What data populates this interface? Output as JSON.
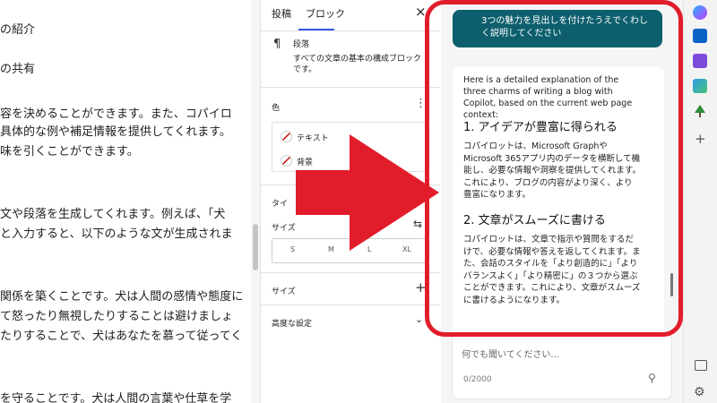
{
  "editor": {
    "lines": [
      "の紹介",
      "の共有",
      "容を決めることができます。また、コパイロ",
      "具体的な例や補足情報を提供してくれます。",
      "味を引くことができます。",
      "文や段落を生成してくれます。例えば、「犬",
      "と入力すると、以下のような文が生成されま",
      "関係を築くことです。犬は人間の感情や態度に",
      "て怒ったり無視したりすることは避けましょ",
      "たりすることで、犬はあなたを慕って従ってく",
      "を守ることです。犬は人間の言葉や仕草を学"
    ]
  },
  "settings": {
    "tabs": [
      "投稿",
      "ブロック"
    ],
    "close_icon": "×",
    "block_title": "段落",
    "block_desc": "すべての文章の基本の構成ブロックです。",
    "color_label": "色",
    "text_color": "テキスト",
    "bg_color": "背景",
    "typography_label": "タイ",
    "size_label": "サイズ",
    "sizes": [
      "S",
      "M",
      "L",
      "XL"
    ],
    "dimensions_label": "サイズ",
    "advanced_label": "高度な設定"
  },
  "copilot": {
    "user_message": "3つの魅力を見出しを付けたうえでくわしく説明してください",
    "intro": "Here is a detailed explanation of the three charms of writing a blog with Copilot, based on the current web page context:",
    "sections": [
      {
        "heading": "1. アイデアが豊富に得られる",
        "body": "コパイロットは、Microsoft GraphやMicrosoft 365アプリ内のデータを横断して機能し、必要な情報や洞察を提供してくれます。これにより、ブログの内容がより深く、より豊富になります。"
      },
      {
        "heading": "2. 文章がスムーズに書ける",
        "body": "コパイロットは、文章で指示や質問をするだけで、必要な情報や答えを返してくれます。また、会話のスタイルを「より創造的に」「よりバランスよく」「より精密に」の３つから選ぶことができます。これにより、文章がスムーズに書けるようになります。"
      }
    ],
    "input_placeholder": "何でも聞いてください...",
    "char_count": "0/2000"
  },
  "colors": {
    "highlight": "#e21d2b",
    "user_bubble": "#0e5f6e",
    "accent": "#3858e9"
  }
}
